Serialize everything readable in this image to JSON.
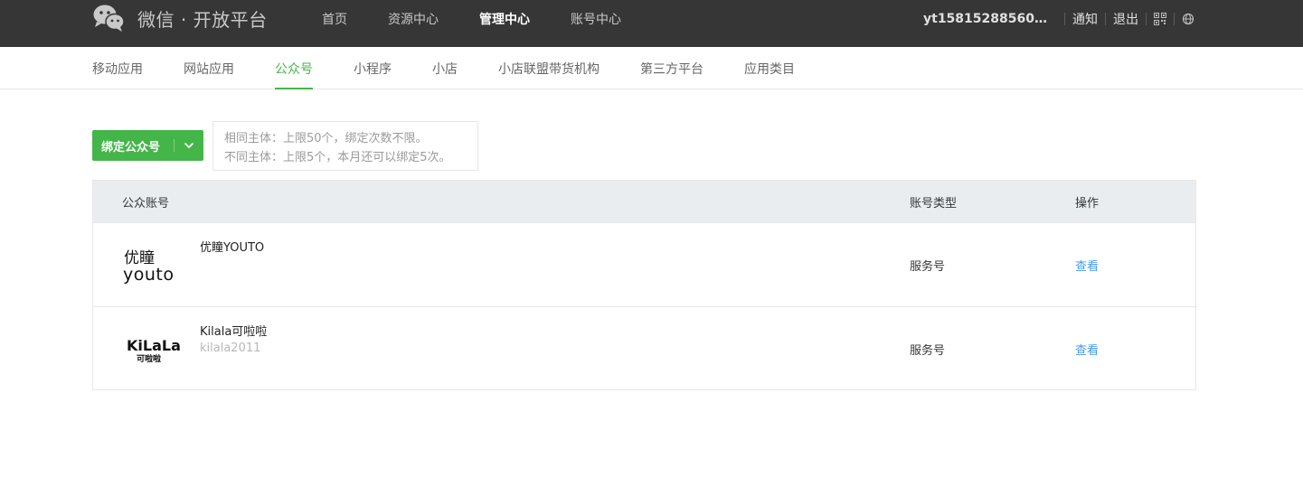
{
  "brand": {
    "name": "微信 · 开放平台"
  },
  "top_nav": {
    "items": [
      {
        "label": "首页",
        "active": false
      },
      {
        "label": "资源中心",
        "active": false
      },
      {
        "label": "管理中心",
        "active": true
      },
      {
        "label": "账号中心",
        "active": false
      }
    ]
  },
  "top_right": {
    "account": "yt15815288560@16...",
    "notify": "通知",
    "logout": "退出",
    "icons": [
      "qr-code-icon",
      "globe-icon"
    ]
  },
  "sub_nav": {
    "items": [
      {
        "label": "移动应用",
        "active": false
      },
      {
        "label": "网站应用",
        "active": false
      },
      {
        "label": "公众号",
        "active": true
      },
      {
        "label": "小程序",
        "active": false
      },
      {
        "label": "小店",
        "active": false
      },
      {
        "label": "小店联盟带货机构",
        "active": false
      },
      {
        "label": "第三方平台",
        "active": false
      },
      {
        "label": "应用类目",
        "active": false
      }
    ]
  },
  "bind": {
    "button_label": "绑定公众号",
    "tip_line1": "相同主体：上限50个，绑定次数不限。",
    "tip_line2": "不同主体：上限5个，本月还可以绑定5次。"
  },
  "table": {
    "headers": {
      "account": "公众账号",
      "type": "账号类型",
      "action": "操作"
    },
    "rows": [
      {
        "name": "优瞳YOUTO",
        "id": "",
        "type": "服务号",
        "action": "查看",
        "logo_text_top": "优瞳",
        "logo_text_bottom": "youto"
      },
      {
        "name": "Kilala可啦啦",
        "id": "kilala2011",
        "type": "服务号",
        "action": "查看",
        "logo_text_top": "KiLaLa",
        "logo_text_bottom": "可啦啦"
      }
    ]
  },
  "colors": {
    "topbar": "#363636",
    "accent_green": "#44b549",
    "link_blue": "#459ae9",
    "table_header": "#e9edf0"
  }
}
